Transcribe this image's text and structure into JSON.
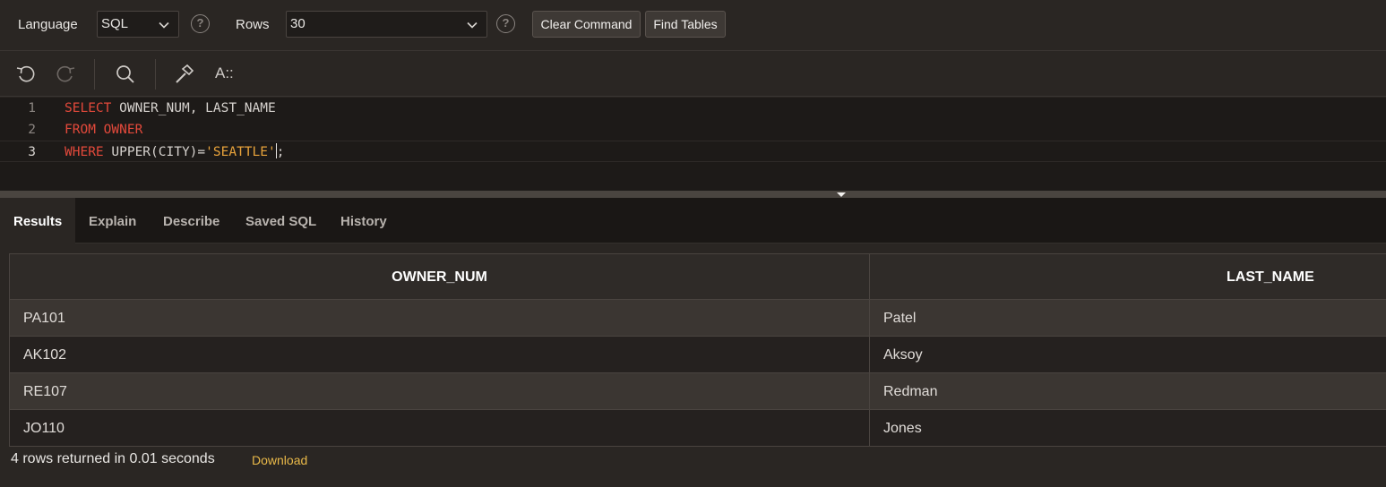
{
  "toolbar": {
    "language_label": "Language",
    "language_value": "SQL",
    "rows_label": "Rows",
    "rows_value": "30",
    "help_glyph": "?",
    "clear_command": "Clear Command",
    "find_tables": "Find Tables"
  },
  "editor_toolbar": {
    "icons": [
      "undo-icon",
      "redo-icon",
      "search-icon",
      "hammer-icon",
      "format-icon"
    ],
    "format_label": "A::"
  },
  "editor": {
    "lines": [
      {
        "num": "1",
        "kw": "SELECT",
        "rest": " OWNER_NUM, LAST_NAME"
      },
      {
        "num": "2",
        "kw": "FROM",
        "rest": " OWNER"
      },
      {
        "num": "3",
        "kw": "WHERE",
        "rest": " UPPER(CITY)=",
        "str": "'SEATTLE'",
        "tail": ";"
      }
    ]
  },
  "tabs": [
    "Results",
    "Explain",
    "Describe",
    "Saved SQL",
    "History"
  ],
  "results": {
    "columns": [
      "OWNER_NUM",
      "LAST_NAME"
    ],
    "rows": [
      [
        "PA101",
        "Patel"
      ],
      [
        "AK102",
        "Aksoy"
      ],
      [
        "RE107",
        "Redman"
      ],
      [
        "JO110",
        "Jones"
      ]
    ],
    "summary": "4 rows returned in 0.01 seconds",
    "download": "Download"
  },
  "colors": {
    "background": "#2a2623",
    "editor_bg": "#1d1a18",
    "keyword": "#e3493b",
    "string": "#e8a33b",
    "link": "#e9b949"
  }
}
